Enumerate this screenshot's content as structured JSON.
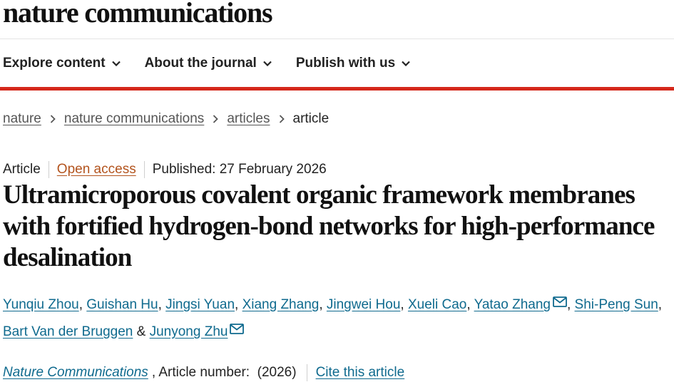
{
  "site": {
    "brand": "nature communications"
  },
  "nav": {
    "items": [
      {
        "label": "Explore content"
      },
      {
        "label": "About the journal"
      },
      {
        "label": "Publish with us"
      }
    ]
  },
  "breadcrumb": {
    "items": [
      "nature",
      "nature communications",
      "articles"
    ],
    "current": "article"
  },
  "article": {
    "type": "Article",
    "access": "Open access",
    "published": "Published: 27 February 2026",
    "title": "Ultramicroporous covalent organic framework membranes with fortified hydrogen-bond networks for high-performance desalination",
    "authors": [
      "Yunqiu Zhou",
      "Guishan Hu",
      "Jingsi Yuan",
      "Xiang Zhang",
      "Jingwei Hou",
      "Xueli Cao",
      "Yatao Zhang",
      "Shi-Peng Sun",
      "Bart Van der Bruggen",
      "Junyong Zhu"
    ],
    "author_sep": ", ",
    "author_amp": " & ",
    "citation": {
      "journal": "Nature Communications",
      "article_number": ", Article number:  (2026)",
      "cite_label": "Cite this article"
    }
  },
  "colors": {
    "accent_red": "#d5281b",
    "link_blue": "#0f6a8e",
    "open_access_orange": "#b3541e"
  },
  "icons": {
    "nav_chevron": "chevron-down-icon",
    "breadcrumb_separator": "chevron-right-icon",
    "corresponding_author": "mail-icon"
  }
}
